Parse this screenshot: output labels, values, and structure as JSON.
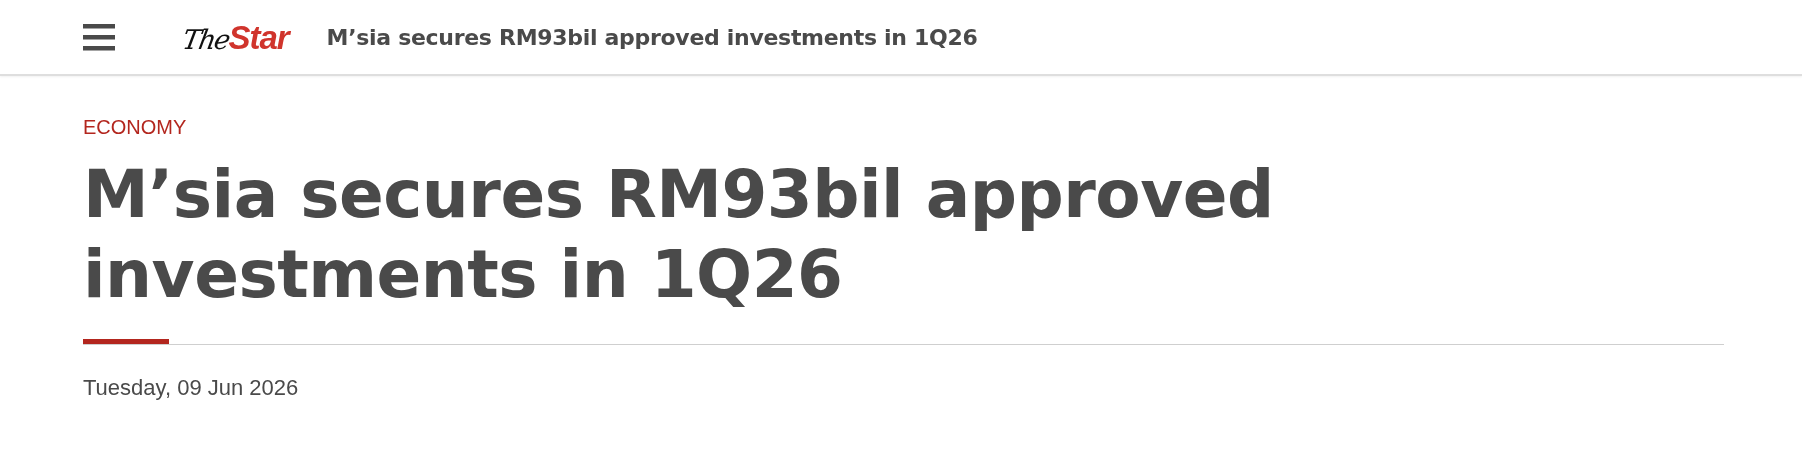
{
  "header": {
    "logo": {
      "part_1": "The",
      "part_2": "Star"
    },
    "title": "M’sia secures RM93bil approved investments in 1Q26"
  },
  "article": {
    "category": "ECONOMY",
    "headline": "M’sia secures RM93bil approved investments in 1Q26",
    "date": "Tuesday, 09 Jun 2026"
  }
}
